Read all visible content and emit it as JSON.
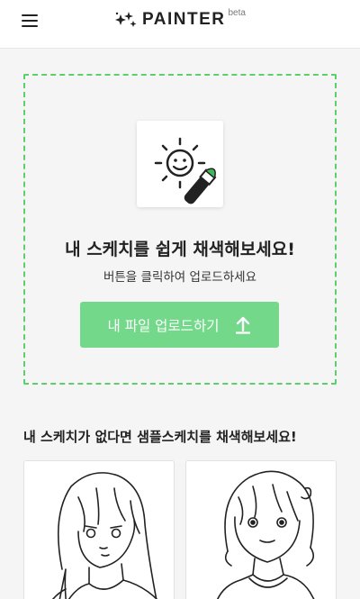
{
  "header": {
    "menu_icon": "hamburger-menu-icon",
    "logo_icon": "sparkle-icon",
    "logo_text": "PAINTER",
    "logo_badge": "beta"
  },
  "upload": {
    "illustration_icon": "sun-brush-icon",
    "title": "내 스케치를 쉽게 채색해보세요!",
    "subtitle": "버튼을 클릭하여 업로드하세요",
    "button_label": "내 파일 업로드하기",
    "button_icon": "upload-arrow-icon"
  },
  "samples": {
    "heading": "내 스케치가 없다면 샘플스케치를 채색해보세요!",
    "items": [
      {
        "kind": "long-hair-girl-sketch"
      },
      {
        "kind": "short-hair-girl-sketch"
      }
    ]
  },
  "colors": {
    "accent": "#73d88a",
    "dashed_border": "#5ccf6a",
    "background": "#f5f5f5"
  }
}
